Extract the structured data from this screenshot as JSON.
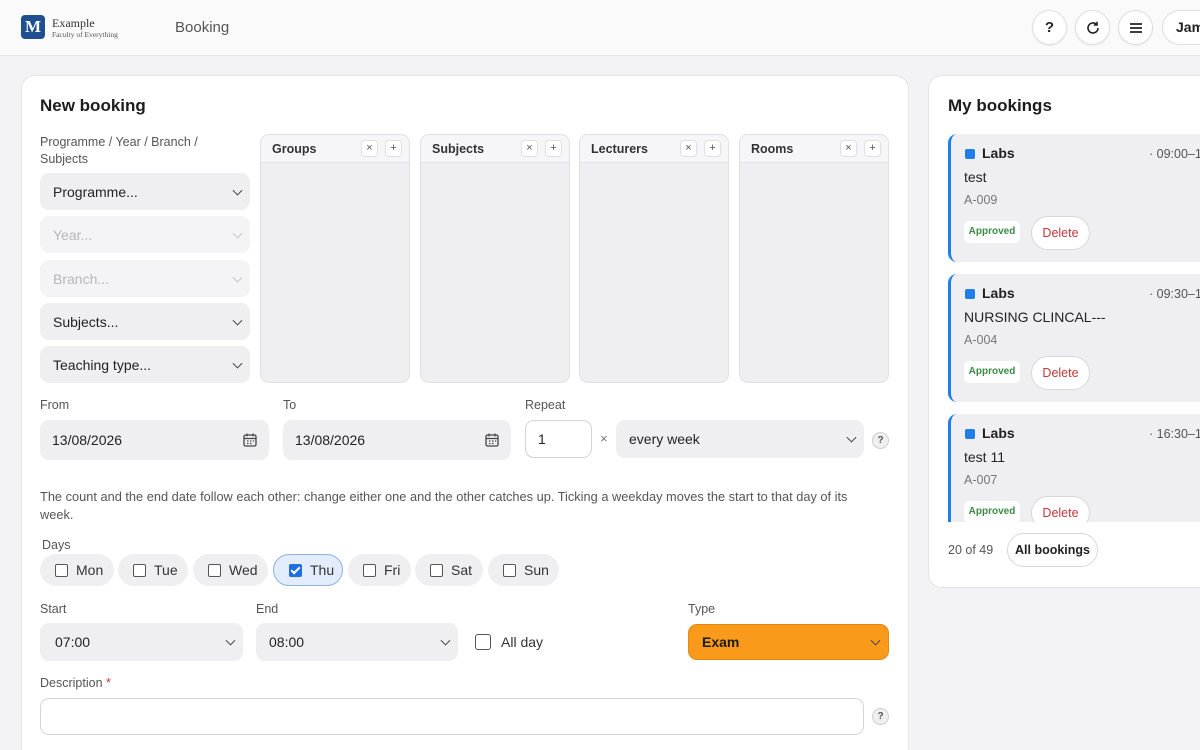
{
  "header": {
    "logo_letter": "M",
    "org_name": "Example",
    "org_sub": "Faculty of Everything",
    "page_title": "Booking",
    "user_label": "Jam"
  },
  "new_booking": {
    "title": "New booking",
    "filters_label": "Programme / Year / Branch / Subjects",
    "programme": "Programme...",
    "year": "Year...",
    "branch": "Branch...",
    "subjects": "Subjects...",
    "teaching_type": "Teaching type...",
    "panels": [
      {
        "title": "Groups"
      },
      {
        "title": "Subjects"
      },
      {
        "title": "Lecturers"
      },
      {
        "title": "Rooms"
      }
    ],
    "panel_remove": "×",
    "panel_add": "+",
    "from_label": "From",
    "from_value": "13/08/2026",
    "to_label": "To",
    "to_value": "13/08/2026",
    "repeat_label": "Repeat",
    "repeat_count": "1",
    "repeat_times": "×",
    "repeat_freq": "every week",
    "hint": "The count and the end date follow each other: change either one and the other catches up. Ticking a weekday moves the start to that day of its week.",
    "days_label": "Days",
    "days": [
      {
        "label": "Mon",
        "checked": false
      },
      {
        "label": "Tue",
        "checked": false
      },
      {
        "label": "Wed",
        "checked": false
      },
      {
        "label": "Thu",
        "checked": true
      },
      {
        "label": "Fri",
        "checked": false
      },
      {
        "label": "Sat",
        "checked": false
      },
      {
        "label": "Sun",
        "checked": false
      }
    ],
    "start_label": "Start",
    "start_value": "07:00",
    "end_label": "End",
    "end_value": "08:00",
    "all_day_label": "All day",
    "type_label": "Type",
    "type_value": "Exam",
    "type_color": "#f99a1a",
    "description_label": "Description",
    "required_mark": "*",
    "help": "?"
  },
  "my_bookings": {
    "title": "My bookings",
    "items": [
      {
        "tag": "Labs",
        "time": "· 09:00–1",
        "name": "test",
        "room": "A-009",
        "status": "Approved",
        "delete": "Delete"
      },
      {
        "tag": "Labs",
        "time": "· 09:30–1",
        "name": "NURSING CLINCAL---",
        "room": "A-004",
        "status": "Approved",
        "delete": "Delete"
      },
      {
        "tag": "Labs",
        "time": "· 16:30–1",
        "name": "test 11",
        "room": "A-007",
        "status": "Approved",
        "delete": "Delete"
      }
    ],
    "count_text": "20 of 49",
    "all_button": "All bookings",
    "accent_color": "#1f7fe6"
  }
}
